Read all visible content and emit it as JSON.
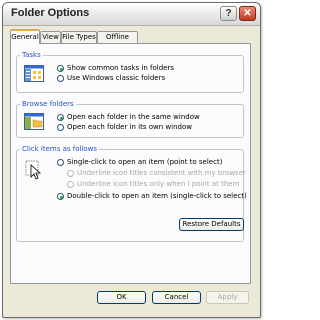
{
  "window": {
    "title": "Folder Options"
  },
  "titlebar": {
    "help_label": "?",
    "close_label": "✕"
  },
  "tabs": [
    {
      "label": "General",
      "active": true
    },
    {
      "label": "View",
      "active": false
    },
    {
      "label": "File Types",
      "active": false
    },
    {
      "label": "Offline Files",
      "active": false
    }
  ],
  "tasks": {
    "legend": "Tasks",
    "options": [
      {
        "label": "Show common tasks in folders",
        "selected": true
      },
      {
        "label": "Use Windows classic folders",
        "selected": false
      }
    ]
  },
  "browse": {
    "legend": "Browse folders",
    "options": [
      {
        "label": "Open each folder in the same window",
        "selected": true
      },
      {
        "label": "Open each folder in its own window",
        "selected": false
      }
    ]
  },
  "click": {
    "legend": "Click items as follows",
    "options": [
      {
        "label": "Single-click to open an item (point to select)",
        "selected": false,
        "enabled": true
      },
      {
        "label": "Underline icon titles consistent with my browser",
        "selected": false,
        "enabled": false
      },
      {
        "label": "Underline icon titles only when I point at them",
        "selected": false,
        "enabled": false
      },
      {
        "label": "Double-click to open an item (single-click to select)",
        "selected": true,
        "enabled": true
      }
    ]
  },
  "buttons": {
    "restore_defaults": "Restore Defaults",
    "ok": "OK",
    "cancel": "Cancel",
    "apply": "Apply"
  },
  "icons": {
    "tasks": "tasks-view-icon",
    "browse": "browse-folders-icon",
    "click": "click-pointer-icon"
  },
  "colors": {
    "accent_tab": "#e3a94e",
    "group_label": "#2154c4",
    "radio_dot": "#23a127"
  }
}
